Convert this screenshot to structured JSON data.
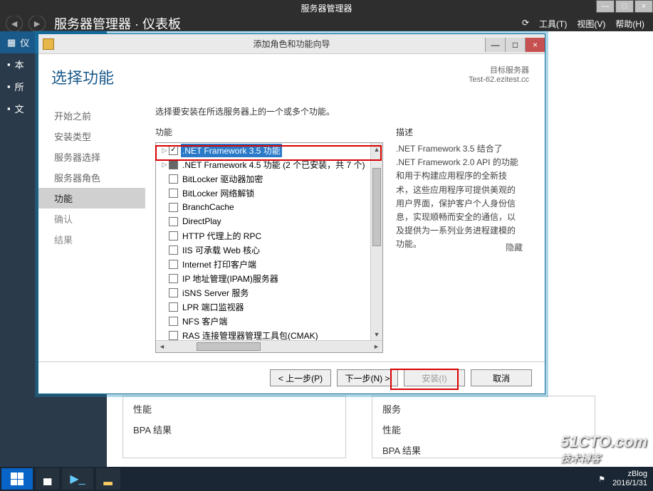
{
  "parent": {
    "title": "服务器管理器",
    "breadcrumb": "服务器管理器 · 仪表板",
    "menus": [
      "工具(T)",
      "视图(V)",
      "帮助(H)"
    ],
    "sidebar": [
      "仪",
      "本",
      "所",
      "文"
    ]
  },
  "dialog": {
    "title": "添加角色和功能向导",
    "heading": "选择功能",
    "dest_label": "目标服务器",
    "dest_value": "Test-62.ezitest.cc",
    "prompt": "选择要安装在所选服务器上的一个或多个功能。",
    "features_label": "功能",
    "desc_label": "描述",
    "hide_label": "隐藏",
    "steps": [
      {
        "label": "开始之前",
        "state": "done"
      },
      {
        "label": "安装类型",
        "state": "done"
      },
      {
        "label": "服务器选择",
        "state": "done"
      },
      {
        "label": "服务器角色",
        "state": "done"
      },
      {
        "label": "功能",
        "state": "active"
      },
      {
        "label": "确认",
        "state": ""
      },
      {
        "label": "结果",
        "state": ""
      }
    ],
    "features": [
      {
        "label": ".NET Framework 3.5 功能",
        "expander": "▷",
        "check": "checked",
        "selected": true
      },
      {
        "label": ".NET Framework 4.5 功能 (2 个已安装，共 7 个)",
        "expander": "▷",
        "check": "partial"
      },
      {
        "label": "BitLocker 驱动器加密",
        "expander": "",
        "check": ""
      },
      {
        "label": "BitLocker 网络解锁",
        "expander": "",
        "check": ""
      },
      {
        "label": "BranchCache",
        "expander": "",
        "check": ""
      },
      {
        "label": "DirectPlay",
        "expander": "",
        "check": ""
      },
      {
        "label": "HTTP 代理上的 RPC",
        "expander": "",
        "check": ""
      },
      {
        "label": "IIS 可承载 Web 核心",
        "expander": "",
        "check": ""
      },
      {
        "label": "Internet 打印客户端",
        "expander": "",
        "check": ""
      },
      {
        "label": "IP 地址管理(IPAM)服务器",
        "expander": "",
        "check": ""
      },
      {
        "label": "iSNS Server 服务",
        "expander": "",
        "check": ""
      },
      {
        "label": "LPR 端口监视器",
        "expander": "",
        "check": ""
      },
      {
        "label": "NFS 客户端",
        "expander": "",
        "check": ""
      },
      {
        "label": "RAS 连接管理器管理工具包(CMAK)",
        "expander": "",
        "check": ""
      }
    ],
    "description": ".NET Framework 3.5 结合了 .NET Framework 2.0 API 的功能和用于构建应用程序的全新技术，这些应用程序可提供美观的用户界面，保护客户个人身份信息，实现顺畅而安全的通信，以及提供为一系列业务进程建模的功能。",
    "buttons": {
      "prev": "< 上一步(P)",
      "next": "下一步(N) >",
      "install": "安装(I)",
      "cancel": "取消"
    }
  },
  "bg_panels": {
    "left": [
      "性能",
      "BPA 结果"
    ],
    "right": [
      "服务",
      "性能",
      "BPA 结果"
    ]
  },
  "taskbar": {
    "time": "zBlog",
    "date": "2016/1/31"
  },
  "watermark": {
    "main": "51CTO.com",
    "sub": "技术博客"
  }
}
